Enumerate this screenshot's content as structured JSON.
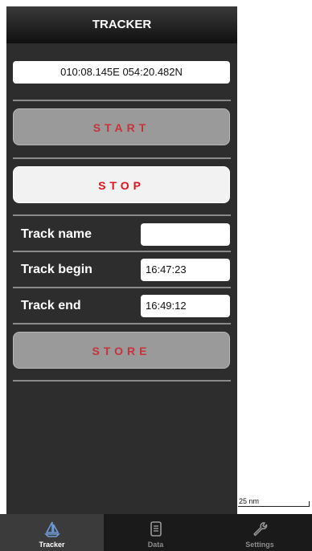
{
  "header": {
    "title": "TRACKER"
  },
  "position": {
    "coordinates": "010:08.145E  054:20.482N"
  },
  "buttons": {
    "start_label": "START",
    "stop_label": "STOP",
    "store_label": "STORE"
  },
  "fields": {
    "track_name": {
      "label": "Track name",
      "value": ""
    },
    "track_begin": {
      "label": "Track begin",
      "value": "16:47:23"
    },
    "track_end": {
      "label": "Track end",
      "value": "16:49:12"
    }
  },
  "map": {
    "scale_label": "25 nm"
  },
  "tabs": [
    {
      "label": "Tracker",
      "icon": "sailboat-icon",
      "selected": true
    },
    {
      "label": "Data",
      "icon": "document-icon",
      "selected": false
    },
    {
      "label": "Settings",
      "icon": "wrench-icon",
      "selected": false
    }
  ],
  "colors": {
    "panel_background": "#2d2d2d",
    "button_text": "#d8282f",
    "tabbar_background": "#1a1a1a"
  }
}
